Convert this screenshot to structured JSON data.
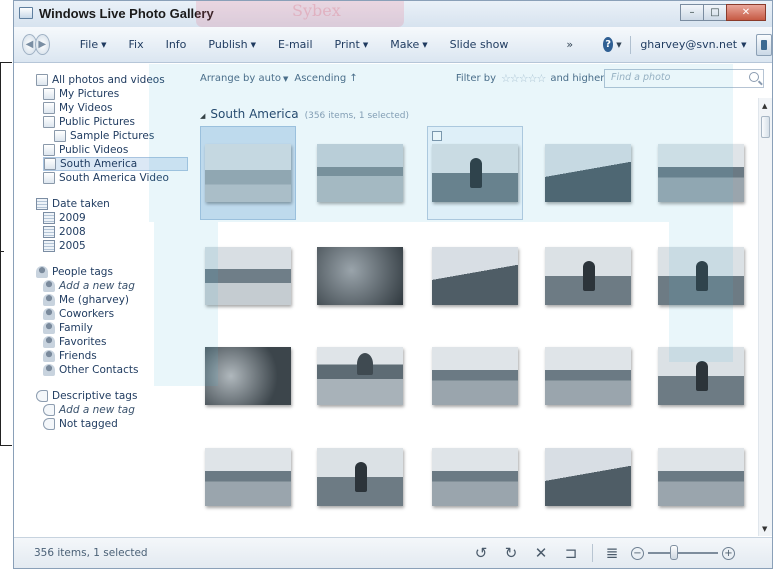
{
  "window": {
    "title": "Windows Live Photo Gallery",
    "minimize": "–",
    "maximize": "□",
    "close": "✕"
  },
  "menu": {
    "back_icon": "back-arrow-icon",
    "forward_icon": "forward-arrow-icon",
    "items": [
      {
        "label": "File",
        "has_dropdown": true
      },
      {
        "label": "Fix",
        "has_dropdown": false
      },
      {
        "label": "Info",
        "has_dropdown": false
      },
      {
        "label": "Publish",
        "has_dropdown": true
      },
      {
        "label": "E-mail",
        "has_dropdown": false
      },
      {
        "label": "Print",
        "has_dropdown": true
      },
      {
        "label": "Make",
        "has_dropdown": true
      },
      {
        "label": "Slide show",
        "has_dropdown": false
      }
    ],
    "overflow": "»",
    "help": "?",
    "account": "gharvey@svn.net"
  },
  "tree": {
    "items": [
      {
        "label": "All photos and videos",
        "level": 0,
        "icon": "folder-icon"
      },
      {
        "label": "My Pictures",
        "level": 1,
        "icon": "folder-icon"
      },
      {
        "label": "My Videos",
        "level": 1,
        "icon": "folder-icon"
      },
      {
        "label": "Public Pictures",
        "level": 1,
        "icon": "folder-icon"
      },
      {
        "label": "Sample Pictures",
        "level": 2,
        "icon": "folder-icon"
      },
      {
        "label": "Public Videos",
        "level": 1,
        "icon": "folder-icon"
      },
      {
        "label": "South America",
        "level": 1,
        "icon": "folder-icon",
        "selected": true
      },
      {
        "label": "South America Video",
        "level": 1,
        "icon": "folder-icon"
      },
      {
        "label": "Date taken",
        "level": 0,
        "icon": "calendar-icon",
        "gap_before": true
      },
      {
        "label": "2009",
        "level": 1,
        "icon": "calendar-icon"
      },
      {
        "label": "2008",
        "level": 1,
        "icon": "calendar-icon"
      },
      {
        "label": "2005",
        "level": 1,
        "icon": "calendar-icon"
      },
      {
        "label": "People tags",
        "level": 0,
        "icon": "people-icon",
        "gap_before": true
      },
      {
        "label": "Add a new tag",
        "level": 1,
        "icon": "add-person-icon",
        "italic": true
      },
      {
        "label": "Me (gharvey)",
        "level": 1,
        "icon": "person-icon"
      },
      {
        "label": "Coworkers",
        "level": 1,
        "icon": "group-icon"
      },
      {
        "label": "Family",
        "level": 1,
        "icon": "group-icon"
      },
      {
        "label": "Favorites",
        "level": 1,
        "icon": "group-icon"
      },
      {
        "label": "Friends",
        "level": 1,
        "icon": "group-icon"
      },
      {
        "label": "Other Contacts",
        "level": 1,
        "icon": "group-icon"
      },
      {
        "label": "Descriptive tags",
        "level": 0,
        "icon": "tag-icon",
        "gap_before": true
      },
      {
        "label": "Add a new tag",
        "level": 1,
        "icon": "add-tag-icon",
        "italic": true
      },
      {
        "label": "Not tagged",
        "level": 1,
        "icon": "tag-icon"
      }
    ]
  },
  "content_header": {
    "arrange": "Arrange by auto",
    "ascending": "Ascending",
    "filter_label": "Filter by",
    "stars": "☆☆☆☆☆",
    "higher": "and higher",
    "search_placeholder": "Find a photo"
  },
  "group": {
    "title": "South America",
    "count": "(356 items, 1 selected)"
  },
  "thumbnails": [
    {
      "kind": "beach",
      "selected": true
    },
    {
      "kind": "beach2"
    },
    {
      "kind": "person",
      "hover": true,
      "checkbox": true
    },
    {
      "kind": "hill"
    },
    {
      "kind": "city"
    },
    {
      "kind": "sea"
    },
    {
      "kind": "dark"
    },
    {
      "kind": "hill"
    },
    {
      "kind": "person"
    },
    {
      "kind": "person"
    },
    {
      "kind": "leaf"
    },
    {
      "kind": "rio"
    },
    {
      "kind": "city"
    },
    {
      "kind": "city"
    },
    {
      "kind": "person"
    },
    {
      "kind": "city"
    },
    {
      "kind": "person"
    },
    {
      "kind": "city"
    },
    {
      "kind": "hill"
    },
    {
      "kind": "city"
    }
  ],
  "status": {
    "text": "356 items, 1 selected",
    "rotate_left": "↺",
    "rotate_right": "↻",
    "delete": "✕",
    "slideshow": "⊐",
    "details": "≣",
    "zoom_minus": "−",
    "zoom_plus": "+",
    "zoom_level": 0.35
  },
  "watermark": "Sybex"
}
